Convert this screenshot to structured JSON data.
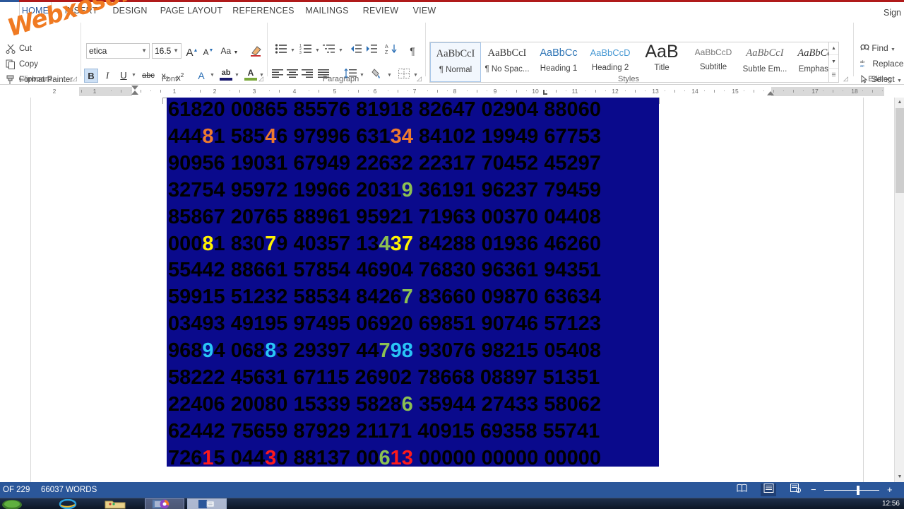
{
  "app": {
    "signin_label": "Sign",
    "accent_blue": "#2b579a",
    "title_red": "#b01a1a"
  },
  "watermark": {
    "text": "Webxoso.net",
    "color": "#f07a22"
  },
  "ribbon": {
    "tabs": [
      {
        "label": "HOME",
        "active": true
      },
      {
        "label": "INSERT",
        "active": false
      },
      {
        "label": "DESIGN",
        "active": false
      },
      {
        "label": "PAGE LAYOUT",
        "active": false
      },
      {
        "label": "REFERENCES",
        "active": false
      },
      {
        "label": "MAILINGS",
        "active": false
      },
      {
        "label": "REVIEW",
        "active": false
      },
      {
        "label": "VIEW",
        "active": false
      }
    ],
    "groups": [
      {
        "label": "Clipboard"
      },
      {
        "label": "Font"
      },
      {
        "label": "Paragraph"
      },
      {
        "label": "Styles"
      },
      {
        "label": "Editing"
      }
    ],
    "clipboard": {
      "cut_label": "Cut",
      "copy_label": "Copy",
      "format_painter_label": "Format Painter"
    },
    "font": {
      "font_name": "etica",
      "font_size": "16.5",
      "grow_label": "A",
      "shrink_label": "A",
      "change_case_label": "Aa",
      "clear_formatting_label": "clear-formatting",
      "bold_label": "B",
      "italic_label": "I",
      "underline_label": "U",
      "strike_label": "abc",
      "subscript_label": "x",
      "superscript_label": "x",
      "text_effects_label": "A",
      "highlight_label": "ab",
      "font_color_label": "A"
    },
    "styles": [
      {
        "preview": "AaBbCcI",
        "name": "¶ Normal",
        "selected": true
      },
      {
        "preview": "AaBbCcI",
        "name": "¶ No Spac...",
        "selected": false
      },
      {
        "preview": "AaBbCc",
        "name": "Heading 1",
        "selected": false
      },
      {
        "preview": "AaBbCcD",
        "name": "Heading 2",
        "selected": false
      },
      {
        "preview": "AaB",
        "name": "Title",
        "selected": false
      },
      {
        "preview": "AaBbCcD",
        "name": "Subtitle",
        "selected": false
      },
      {
        "preview": "AaBbCcI",
        "name": "Subtle Em...",
        "selected": false
      },
      {
        "preview": "AaBbCcI",
        "name": "Emphasis",
        "selected": false
      }
    ],
    "editing": {
      "find_label": "Find",
      "replace_label": "Replace",
      "select_label": "Select"
    }
  },
  "ruler": {
    "ticks": [
      "2",
      "1",
      "1",
      "2",
      "3",
      "4",
      "5",
      "6",
      "7",
      "8",
      "9",
      "10",
      "11",
      "12",
      "13",
      "14",
      "15",
      "17",
      "18"
    ]
  },
  "document": {
    "selection_bg": "#0a0a8c",
    "rows": [
      {
        "groups": [
          {
            "t": "61820",
            "c": null
          },
          {
            "t": "00865",
            "c": null
          },
          {
            "t": "85576",
            "c": null
          },
          {
            "t": "81918",
            "c": null
          },
          {
            "t": "82647",
            "c": null
          },
          {
            "t": "02904",
            "c": null
          },
          {
            "t": "88060",
            "c": null
          }
        ]
      },
      {
        "groups": [
          {
            "t": "444",
            "c": null
          },
          {
            "t": "8",
            "c": "#ee7b2e"
          },
          {
            "t": "1",
            "c": null
          },
          {
            "t": " ",
            "c": null
          },
          {
            "t": "585",
            "c": null
          },
          {
            "t": "4",
            "c": "#ee7b2e"
          },
          {
            "t": "6",
            "c": null
          },
          {
            "t": " ",
            "c": null
          },
          {
            "t": "97996",
            "c": null
          },
          {
            "t": " ",
            "c": null
          },
          {
            "t": "631",
            "c": null
          },
          {
            "t": "34",
            "c": "#ee7b2e"
          },
          {
            "t": " ",
            "c": null
          },
          {
            "t": "84102",
            "c": null
          },
          {
            "t": " ",
            "c": null
          },
          {
            "t": "19949",
            "c": null
          },
          {
            "t": " ",
            "c": null
          },
          {
            "t": "67753",
            "c": null
          }
        ]
      },
      {
        "groups": [
          {
            "t": "90956",
            "c": null
          },
          {
            "t": "19031",
            "c": null
          },
          {
            "t": "67949",
            "c": null
          },
          {
            "t": "22632",
            "c": null
          },
          {
            "t": "22317",
            "c": null
          },
          {
            "t": "70452",
            "c": null
          },
          {
            "t": "45297",
            "c": null
          }
        ]
      },
      {
        "groups": [
          {
            "t": "32754",
            "c": null
          },
          {
            "t": " ",
            "c": null
          },
          {
            "t": "95972",
            "c": null
          },
          {
            "t": " ",
            "c": null
          },
          {
            "t": "19966",
            "c": null
          },
          {
            "t": " ",
            "c": null
          },
          {
            "t": "2031",
            "c": null
          },
          {
            "t": "9",
            "c": "#8cc152"
          },
          {
            "t": " ",
            "c": null
          },
          {
            "t": "36191",
            "c": null
          },
          {
            "t": " ",
            "c": null
          },
          {
            "t": "96237",
            "c": null
          },
          {
            "t": " ",
            "c": null
          },
          {
            "t": "79459",
            "c": null
          }
        ]
      },
      {
        "groups": [
          {
            "t": "85867",
            "c": null
          },
          {
            "t": "20765",
            "c": null
          },
          {
            "t": "88961",
            "c": null
          },
          {
            "t": "95921",
            "c": null
          },
          {
            "t": "71963",
            "c": null
          },
          {
            "t": "00370",
            "c": null
          },
          {
            "t": "04408",
            "c": null
          }
        ]
      },
      {
        "groups": [
          {
            "t": "000",
            "c": null
          },
          {
            "t": "8",
            "c": "#fff200"
          },
          {
            "t": "1",
            "c": null
          },
          {
            "t": " ",
            "c": null
          },
          {
            "t": "830",
            "c": null
          },
          {
            "t": "7",
            "c": "#fff200"
          },
          {
            "t": "9",
            "c": null
          },
          {
            "t": " ",
            "c": null
          },
          {
            "t": "40357",
            "c": null
          },
          {
            "t": " ",
            "c": null
          },
          {
            "t": "13",
            "c": null
          },
          {
            "t": "4",
            "c": "#8cc152"
          },
          {
            "t": "37",
            "c": "#fff200"
          },
          {
            "t": " ",
            "c": null
          },
          {
            "t": "84288",
            "c": null
          },
          {
            "t": " ",
            "c": null
          },
          {
            "t": "01936",
            "c": null
          },
          {
            "t": " ",
            "c": null
          },
          {
            "t": "46260",
            "c": null
          }
        ]
      },
      {
        "groups": [
          {
            "t": "55442",
            "c": null
          },
          {
            "t": "88661",
            "c": null
          },
          {
            "t": "57854",
            "c": null
          },
          {
            "t": "46904",
            "c": null
          },
          {
            "t": "76830",
            "c": null
          },
          {
            "t": "96361",
            "c": null
          },
          {
            "t": "94351",
            "c": null
          }
        ]
      },
      {
        "groups": [
          {
            "t": "59915",
            "c": null
          },
          {
            "t": " ",
            "c": null
          },
          {
            "t": "51232",
            "c": null
          },
          {
            "t": " ",
            "c": null
          },
          {
            "t": "58534",
            "c": null
          },
          {
            "t": " ",
            "c": null
          },
          {
            "t": "8426",
            "c": null
          },
          {
            "t": "7",
            "c": "#8cc152"
          },
          {
            "t": " ",
            "c": null
          },
          {
            "t": "83660",
            "c": null
          },
          {
            "t": " ",
            "c": null
          },
          {
            "t": "09870",
            "c": null
          },
          {
            "t": " ",
            "c": null
          },
          {
            "t": "63634",
            "c": null
          }
        ]
      },
      {
        "groups": [
          {
            "t": "03493",
            "c": null
          },
          {
            "t": "49195",
            "c": null
          },
          {
            "t": "97495",
            "c": null
          },
          {
            "t": "06920",
            "c": null
          },
          {
            "t": "69851",
            "c": null
          },
          {
            "t": "90746",
            "c": null
          },
          {
            "t": "57123",
            "c": null
          }
        ]
      },
      {
        "groups": [
          {
            "t": "968",
            "c": null
          },
          {
            "t": "9",
            "c": "#29c5f6"
          },
          {
            "t": "4",
            "c": null
          },
          {
            "t": " ",
            "c": null
          },
          {
            "t": "068",
            "c": null
          },
          {
            "t": "8",
            "c": "#29c5f6"
          },
          {
            "t": "3",
            "c": null
          },
          {
            "t": " ",
            "c": null
          },
          {
            "t": "29397",
            "c": null
          },
          {
            "t": " ",
            "c": null
          },
          {
            "t": "44",
            "c": null
          },
          {
            "t": "7",
            "c": "#8cc152"
          },
          {
            "t": "98",
            "c": "#29c5f6"
          },
          {
            "t": " ",
            "c": null
          },
          {
            "t": "93076",
            "c": null
          },
          {
            "t": " ",
            "c": null
          },
          {
            "t": "98215",
            "c": null
          },
          {
            "t": " ",
            "c": null
          },
          {
            "t": "05408",
            "c": null
          }
        ]
      },
      {
        "groups": [
          {
            "t": "58222",
            "c": null
          },
          {
            "t": "45631",
            "c": null
          },
          {
            "t": "67115",
            "c": null
          },
          {
            "t": "26902",
            "c": null
          },
          {
            "t": "78668",
            "c": null
          },
          {
            "t": "08897",
            "c": null
          },
          {
            "t": "51351",
            "c": null
          }
        ]
      },
      {
        "groups": [
          {
            "t": "22406",
            "c": null
          },
          {
            "t": " ",
            "c": null
          },
          {
            "t": "20080",
            "c": null
          },
          {
            "t": " ",
            "c": null
          },
          {
            "t": "15339",
            "c": null
          },
          {
            "t": " ",
            "c": null
          },
          {
            "t": "5828",
            "c": null
          },
          {
            "t": "6",
            "c": "#8cc152"
          },
          {
            "t": " ",
            "c": null
          },
          {
            "t": "35944",
            "c": null
          },
          {
            "t": " ",
            "c": null
          },
          {
            "t": "27433",
            "c": null
          },
          {
            "t": " ",
            "c": null
          },
          {
            "t": "58062",
            "c": null
          }
        ]
      },
      {
        "groups": [
          {
            "t": "62442",
            "c": null
          },
          {
            "t": "75659",
            "c": null
          },
          {
            "t": "87929",
            "c": null
          },
          {
            "t": "21171",
            "c": null
          },
          {
            "t": "40915",
            "c": null
          },
          {
            "t": "69358",
            "c": null
          },
          {
            "t": "55741",
            "c": null
          }
        ]
      },
      {
        "groups": [
          {
            "t": "726",
            "c": null
          },
          {
            "t": "1",
            "c": "#ff1a1a"
          },
          {
            "t": "5",
            "c": null
          },
          {
            "t": " ",
            "c": null
          },
          {
            "t": "044",
            "c": null
          },
          {
            "t": "3",
            "c": "#ff1a1a"
          },
          {
            "t": "0",
            "c": null
          },
          {
            "t": " ",
            "c": null
          },
          {
            "t": "88137",
            "c": null
          },
          {
            "t": " ",
            "c": null
          },
          {
            "t": "00",
            "c": null
          },
          {
            "t": "6",
            "c": "#8cc152"
          },
          {
            "t": "13",
            "c": "#ff1a1a"
          },
          {
            "t": " ",
            "c": null
          },
          {
            "t": "00000",
            "c": null
          },
          {
            "t": " ",
            "c": null
          },
          {
            "t": "00000",
            "c": null
          },
          {
            "t": " ",
            "c": null
          },
          {
            "t": "00000",
            "c": null
          }
        ]
      }
    ]
  },
  "status": {
    "page_label": "OF 229",
    "words_label": "66037 WORDS",
    "views": [
      {
        "name": "read-mode",
        "active": false
      },
      {
        "name": "print-layout",
        "active": true
      },
      {
        "name": "web-layout",
        "active": false
      }
    ],
    "zoom_out": "−",
    "zoom_in": "+"
  },
  "taskbar": {
    "clock": "12:56"
  }
}
